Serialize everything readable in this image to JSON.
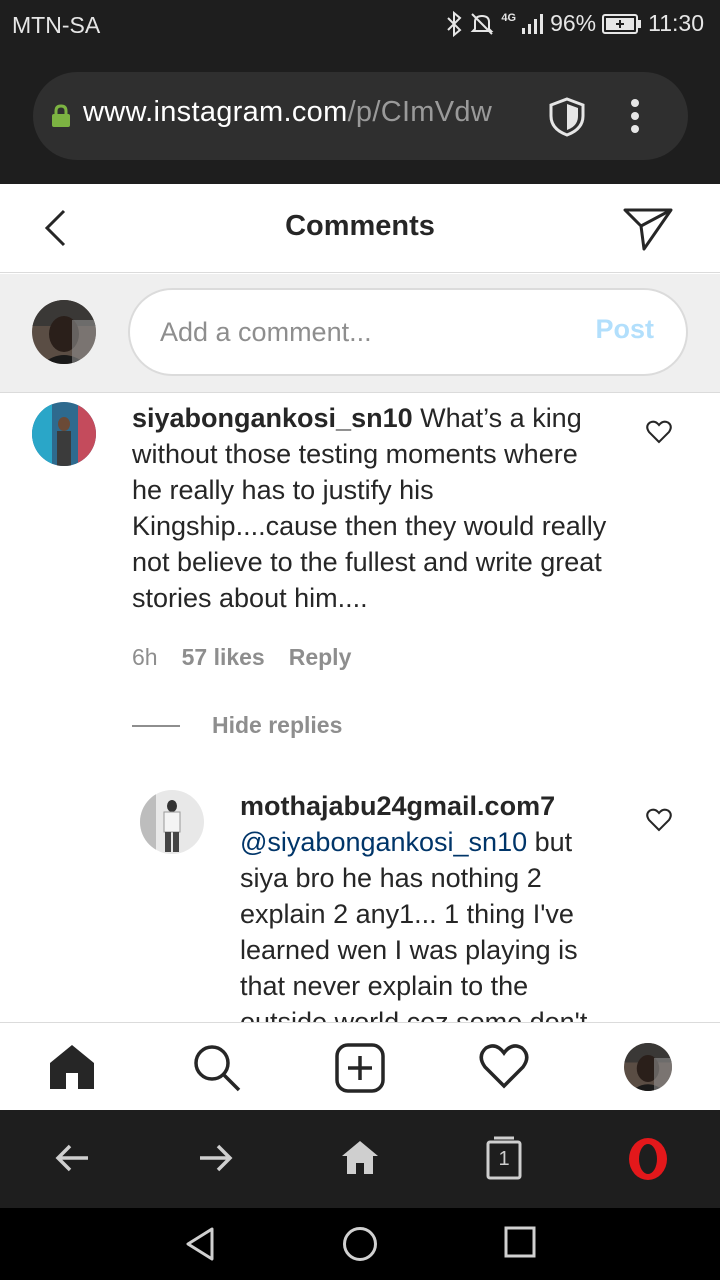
{
  "status_bar": {
    "carrier": "MTN-SA",
    "network": "4G",
    "battery": "96%",
    "time": "11:30"
  },
  "browser": {
    "url_host": "www.instagram.com",
    "url_path": "/p/CImVdw"
  },
  "header": {
    "title": "Comments"
  },
  "composer": {
    "placeholder": "Add a comment...",
    "post_label": "Post"
  },
  "comments": [
    {
      "username": "siyabongankosi_sn10",
      "text": "What’s a king without those testing moments where he really has to justify his Kingship....cause then they would really not believe to the fullest and write great stories about him....",
      "time": "6h",
      "likes": "57 likes",
      "reply_label": "Reply",
      "hide_replies_label": "Hide replies"
    },
    {
      "username": "mothajabu24gmail.com7",
      "mention": "@siyabongankosi_sn10",
      "text": "but siya bro he has nothing 2 explain 2 any1... 1 thing I've learned wen I was playing is that never explain to the outside world coz some don't"
    }
  ],
  "bottom_nav": [
    "home-icon",
    "search-icon",
    "new-post-icon",
    "activity-heart-icon",
    "profile-avatar"
  ],
  "opera_bar": {
    "tab_count": "1"
  },
  "colors": {
    "post_disabled": "#b2dffc",
    "mention": "#003569",
    "opera_red": "#e3181b",
    "secure_lock": "#7cb342"
  }
}
